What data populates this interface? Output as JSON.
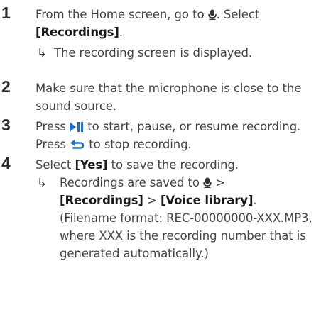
{
  "steps": [
    {
      "number": "1",
      "text_before": "From the Home screen, go to",
      "icon": "microphone-icon",
      "text_after": ". Select",
      "bold": "[Recordings]",
      "bold_after": ".",
      "result": "The recording screen is displayed."
    },
    {
      "number": "2",
      "text": "Make sure that the microphone is close to the sound source."
    },
    {
      "number": "3",
      "press1": "Press",
      "icon1": "play-pause-icon",
      "mid": "to start, pause, or resume recording. Press",
      "icon2": "back-icon",
      "end": "to stop recording."
    },
    {
      "number": "4",
      "select": "Select",
      "bold": "[Yes]",
      "rest": "to save the recording.",
      "result_prefix": "Recordings are saved to",
      "icon": "microphone-icon",
      "sep1": ">",
      "path1": "[Recordings]",
      "sep2": ">",
      "path2": "[Voice library]",
      "path_end": ".",
      "note": "(Filename format: REC-00000000-XXX.MP3, where XXX is the recording number that is generated automatically.)"
    }
  ]
}
